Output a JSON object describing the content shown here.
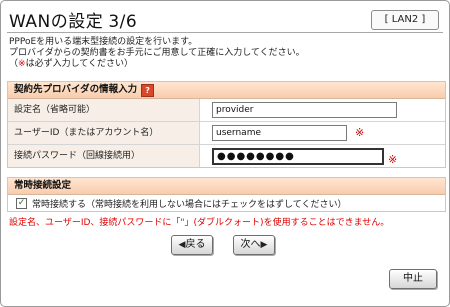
{
  "header": {
    "title": "WANの設定",
    "step_current": "3",
    "step_total": "/6",
    "badge": "[ LAN2 ]"
  },
  "intro": {
    "line1": "PPPoEを用いる端末型接続の設定を行います。",
    "line2": "プロバイダからの契約書をお手元にご用意して正確に入力してください。",
    "line3_prefix": "（",
    "line3_mark": "※",
    "line3_suffix": "は必ず入力してください）"
  },
  "provider_section": {
    "heading": "契約先プロバイダの情報入力",
    "help_icon": "?",
    "rows": [
      {
        "label": "設定名（省略可能）",
        "value": "provider"
      },
      {
        "label": "ユーザーID（またはアカウント名）",
        "value": "username",
        "required_mark": "※"
      },
      {
        "label": "接続パスワード（回線接続用）",
        "value": "●●●●●●●●",
        "required_mark": "※"
      }
    ]
  },
  "always_on_section": {
    "heading": "常時接続設定",
    "checkbox_checked": true,
    "checkbox_mark": "✓",
    "checkbox_label": "常時接続する（常時接続を利用しない場合にはチェックをはずしてください）"
  },
  "warning": "設定名、ユーザーID、接続パスワードに「\"」(ダブルクォート)を使用することはできません。",
  "buttons": {
    "back": "戻る",
    "next": "次へ",
    "cancel": "中止"
  },
  "colors": {
    "accent_orange": "#d86a1e",
    "required_red": "#e00000",
    "section_header_bg": "#f8ccae",
    "label_cell_bg": "#f7efe7"
  }
}
